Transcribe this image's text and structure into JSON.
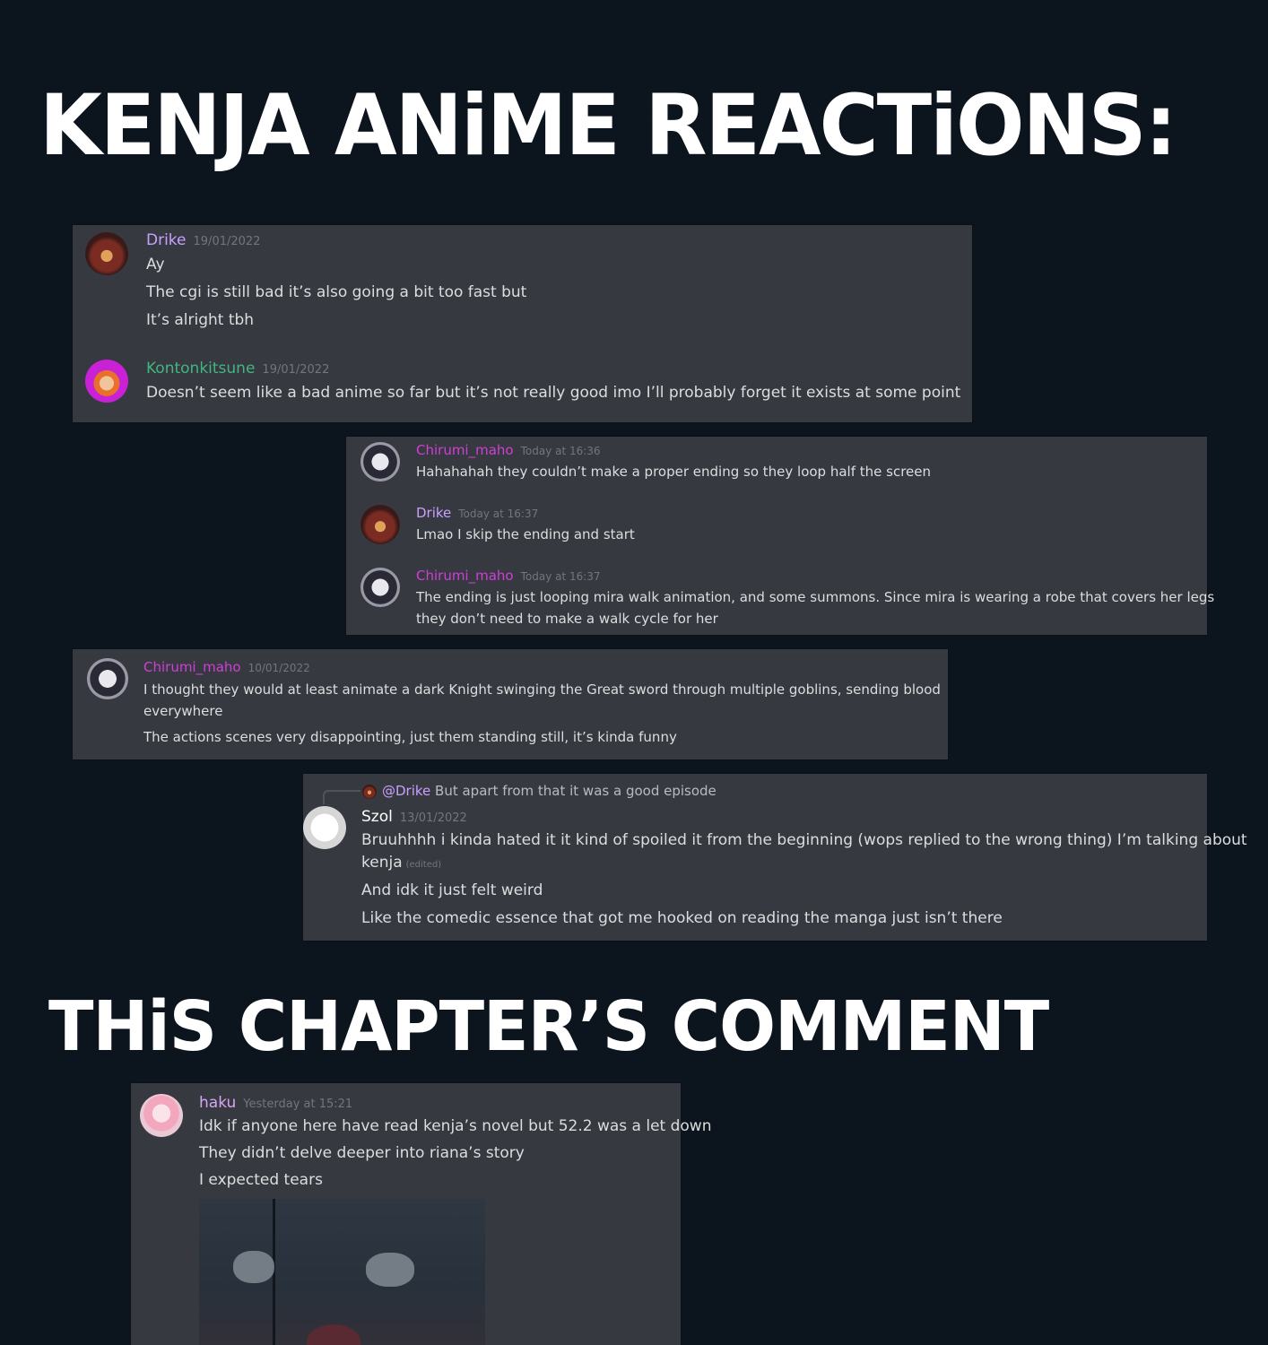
{
  "headings": {
    "first": "KENJA ANiME REACTiONS:",
    "second": "THiS CHAPTER’S COMMENT"
  },
  "colors": {
    "background": "#0c141e",
    "panel": "#36393f",
    "drike": "#c9a0ff",
    "kontonkitsune": "#43b581",
    "chirumi": "#d13ed8",
    "szol": "#ffffff",
    "haku": "#d6a6f5"
  },
  "panel1": {
    "msg1": {
      "author": "Drike",
      "timestamp": "19/01/2022",
      "lines": [
        "Ay",
        "The cgi is still bad it’s also going a bit too fast but",
        "It’s alright tbh"
      ]
    },
    "msg2": {
      "author": "Kontonkitsune",
      "timestamp": "19/01/2022",
      "lines": [
        "Doesn’t seem like a bad anime so far but it’s not really good imo I’ll probably forget it exists at some point"
      ]
    }
  },
  "panel2": {
    "msg1": {
      "author": "Chirumi_maho",
      "timestamp": "Today at 16:36",
      "lines": [
        "Hahahahah they couldn’t make a proper ending so they loop half the screen"
      ]
    },
    "msg2": {
      "author": "Drike",
      "timestamp": "Today at 16:37",
      "lines": [
        "Lmao I skip the ending and start"
      ]
    },
    "msg3": {
      "author": "Chirumi_maho",
      "timestamp": "Today at 16:37",
      "lines": [
        "The ending is just looping mira walk animation, and some summons. Since mira is wearing a robe that covers her legs",
        "they don’t need to make a walk cycle for her"
      ]
    }
  },
  "panel3": {
    "msg1": {
      "author": "Chirumi_maho",
      "timestamp": "10/01/2022",
      "lines": [
        "I thought they would at least animate a dark Knight swinging the Great sword through multiple goblins, sending blood",
        "everywhere",
        "The actions scenes very disappointing, just them standing still, it’s kinda funny"
      ]
    }
  },
  "panel4": {
    "reply": {
      "mention": "@Drike",
      "text": "But apart from that it was a good episode"
    },
    "msg1": {
      "author": "Szol",
      "timestamp": "13/01/2022",
      "lines": [
        "Bruuhhhh i kinda hated it it kind of spoiled it from the beginning (wops replied to the wrong thing) I’m talking about",
        "kenja",
        "And idk it just felt weird",
        "Like the comedic essence that got me hooked on reading the manga just isn’t there"
      ],
      "edited": "(edited)"
    }
  },
  "panel5": {
    "msg1": {
      "author": "haku",
      "timestamp": "Yesterday at 15:21",
      "lines": [
        "Idk if anyone here have read kenja’s novel but 52.2 was a let down",
        "They didn’t delve deeper into riana’s story",
        "I expected tears"
      ]
    }
  }
}
